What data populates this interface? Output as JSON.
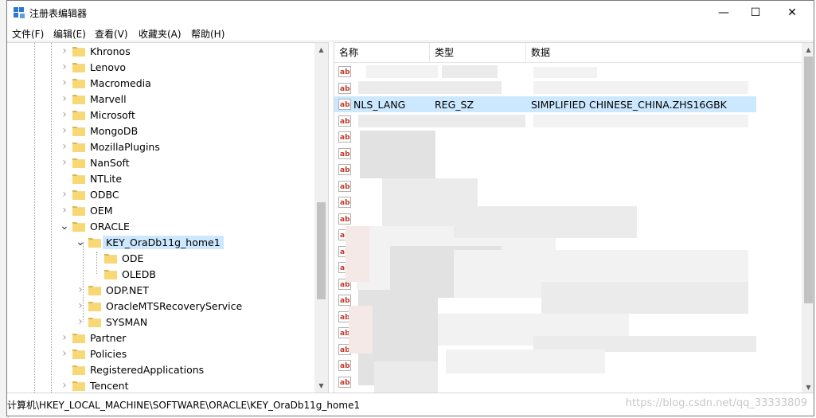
{
  "window": {
    "title": "注册表编辑器",
    "minimize_glyph": "—",
    "maximize_glyph": "☐",
    "close_glyph": "✕"
  },
  "menu": [
    "文件(F)",
    "编辑(E)",
    "查看(V)",
    "收藏夹(A)",
    "帮助(H)"
  ],
  "tree": [
    {
      "label": "Khronos",
      "level": 0,
      "expander": "collapsed"
    },
    {
      "label": "Lenovo",
      "level": 0,
      "expander": "collapsed"
    },
    {
      "label": "Macromedia",
      "level": 0,
      "expander": "collapsed"
    },
    {
      "label": "Marvell",
      "level": 0,
      "expander": "collapsed"
    },
    {
      "label": "Microsoft",
      "level": 0,
      "expander": "collapsed"
    },
    {
      "label": "MongoDB",
      "level": 0,
      "expander": "collapsed"
    },
    {
      "label": "MozillaPlugins",
      "level": 0,
      "expander": "collapsed"
    },
    {
      "label": "NanSoft",
      "level": 0,
      "expander": "collapsed"
    },
    {
      "label": "NTLite",
      "level": 0,
      "expander": "none"
    },
    {
      "label": "ODBC",
      "level": 0,
      "expander": "collapsed"
    },
    {
      "label": "OEM",
      "level": 0,
      "expander": "collapsed"
    },
    {
      "label": "ORACLE",
      "level": 0,
      "expander": "expanded"
    },
    {
      "label": "KEY_OraDb11g_home1",
      "level": 1,
      "expander": "expanded",
      "selected": true
    },
    {
      "label": "ODE",
      "level": 2,
      "expander": "none"
    },
    {
      "label": "OLEDB",
      "level": 2,
      "expander": "none"
    },
    {
      "label": "ODP.NET",
      "level": 1,
      "expander": "collapsed"
    },
    {
      "label": "OracleMTSRecoveryService",
      "level": 1,
      "expander": "collapsed"
    },
    {
      "label": "SYSMAN",
      "level": 1,
      "expander": "collapsed"
    },
    {
      "label": "Partner",
      "level": 0,
      "expander": "collapsed"
    },
    {
      "label": "Policies",
      "level": 0,
      "expander": "collapsed"
    },
    {
      "label": "RegisteredApplications",
      "level": 0,
      "expander": "none"
    },
    {
      "label": "Tencent",
      "level": 0,
      "expander": "collapsed"
    }
  ],
  "list": {
    "columns": [
      "名称",
      "类型",
      "数据"
    ],
    "rows": [
      {
        "name": "",
        "type": "",
        "data": ""
      },
      {
        "name": "",
        "type": "",
        "data": ""
      },
      {
        "name": "NLS_LANG",
        "type": "REG_SZ",
        "data": "SIMPLIFIED CHINESE_CHINA.ZHS16GBK",
        "selected": true
      },
      {
        "name": "",
        "type": "",
        "data": ""
      },
      {
        "name": "",
        "type": "",
        "data": ""
      },
      {
        "name": "",
        "type": "",
        "data": ""
      },
      {
        "name": "",
        "type": "",
        "data": ""
      },
      {
        "name": "",
        "type": "",
        "data": ""
      },
      {
        "name": "",
        "type": "",
        "data": ""
      },
      {
        "name": "",
        "type": "",
        "data": ""
      },
      {
        "name": "",
        "type": "",
        "data": ""
      },
      {
        "name": "",
        "type": "",
        "data": ""
      },
      {
        "name": "",
        "type": "",
        "data": ""
      },
      {
        "name": "",
        "type": "",
        "data": ""
      },
      {
        "name": "",
        "type": "",
        "data": ""
      },
      {
        "name": "",
        "type": "",
        "data": ""
      },
      {
        "name": "",
        "type": "",
        "data": ""
      },
      {
        "name": "",
        "type": "",
        "data": ""
      },
      {
        "name": "",
        "type": "",
        "data": ""
      },
      {
        "name": "",
        "type": "",
        "data": ""
      },
      {
        "name": "",
        "type": "",
        "data": ""
      }
    ]
  },
  "status": {
    "path": "计算机\\HKEY_LOCAL_MACHINE\\SOFTWARE\\ORACLE\\KEY_OraDb11g_home1",
    "watermark": "https://blog.csdn.net/qq_33333809"
  },
  "colors": {
    "selection": "#cce8ff",
    "folder": "#f8d775",
    "folder_dark": "#e0b44c",
    "ab_red": "#c0392b"
  }
}
